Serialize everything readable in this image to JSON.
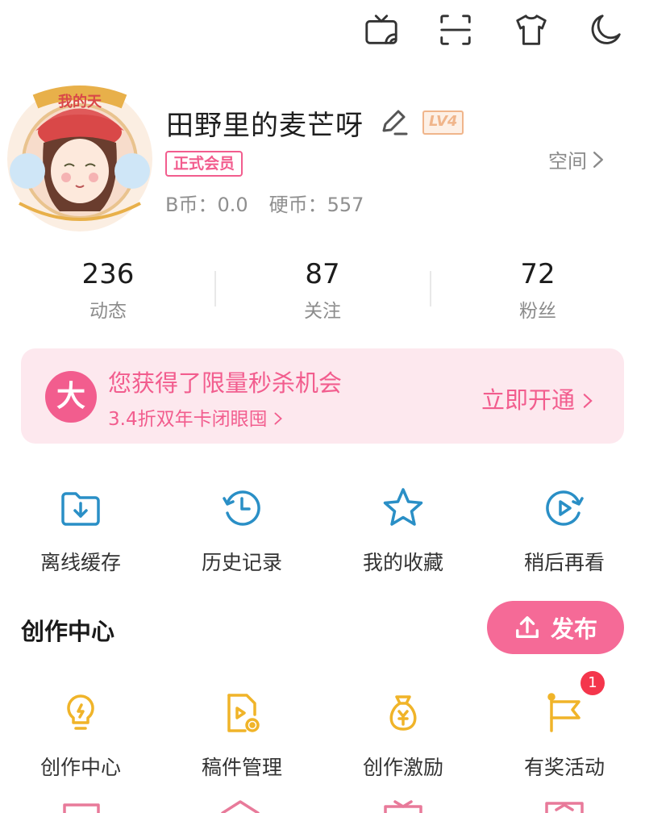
{
  "topbar": {
    "icons": [
      "tv-cast-icon",
      "scan-icon",
      "theme-shirt-icon",
      "night-mode-icon"
    ]
  },
  "profile": {
    "avatar_text": "我的天",
    "username": "田野里的麦芒呀",
    "level": "LV4",
    "vip_label": "正式会员",
    "bcoin": "B币：0.0",
    "coin": "硬币：557",
    "space_label": "空间"
  },
  "stats": [
    {
      "value": "236",
      "label": "动态"
    },
    {
      "value": "87",
      "label": "关注"
    },
    {
      "value": "72",
      "label": "粉丝"
    }
  ],
  "promo": {
    "logo": "大",
    "title": "您获得了限量秒杀机会",
    "subtitle": "3.4折双年卡闭眼囤",
    "cta": "立即开通"
  },
  "shortcuts": [
    {
      "label": "离线缓存",
      "icon": "download-folder-icon"
    },
    {
      "label": "历史记录",
      "icon": "history-clock-icon"
    },
    {
      "label": "我的收藏",
      "icon": "star-icon"
    },
    {
      "label": "稍后再看",
      "icon": "watch-later-icon"
    }
  ],
  "creator": {
    "section_title": "创作中心",
    "publish_label": "发布",
    "items": [
      {
        "label": "创作中心",
        "icon": "lightbulb-icon"
      },
      {
        "label": "稿件管理",
        "icon": "manuscript-icon"
      },
      {
        "label": "创作激励",
        "icon": "money-bag-icon"
      },
      {
        "label": "有奖活动",
        "icon": "flag-icon"
      }
    ],
    "activity_badge": "1"
  },
  "colors": {
    "accent_pink": "#f25d8e",
    "icon_blue": "#2a8fc6",
    "icon_yellow": "#f0b429",
    "level_orange": "#f0b58b"
  }
}
